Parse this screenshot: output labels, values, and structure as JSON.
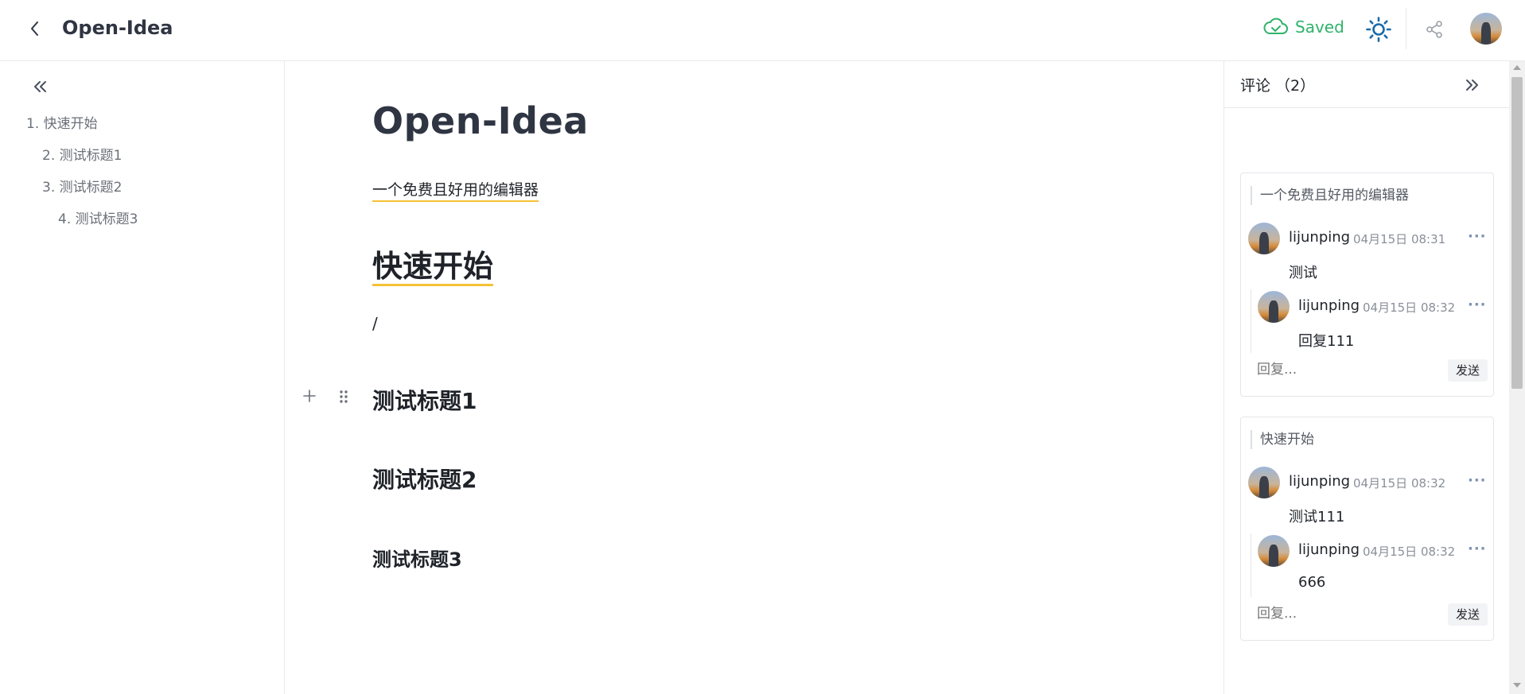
{
  "header": {
    "back_icon": "chevron-left-icon",
    "title": "Open-Idea",
    "saved_icon": "cloud-check-icon",
    "saved_label": "Saved",
    "theme_icon": "sun-icon",
    "share_icon": "share-icon",
    "colors": {
      "saved": "#2fb36b",
      "theme": "#1a6aa8"
    }
  },
  "sidebar": {
    "collapse_icon": "double-chevron-left-icon",
    "toc": [
      {
        "label": "1. 快速开始"
      },
      {
        "label": "2. 测试标题1"
      },
      {
        "label": "3. 测试标题2"
      },
      {
        "label": "4. 测试标题3"
      }
    ]
  },
  "editor": {
    "title": "Open-Idea",
    "subtitle": "一个免费且好用的编辑器",
    "h1": "快速开始",
    "slash": "/",
    "h2a": "测试标题1",
    "h2b": "测试标题2",
    "h3": "测试标题3",
    "add_icon": "plus-icon",
    "drag_icon": "drag-handle-icon",
    "highlight_color": "#f5c234"
  },
  "comments": {
    "title": "评论 （2）",
    "collapse_icon": "double-chevron-right-icon",
    "cards": [
      {
        "quote": "一个免费且好用的编辑器",
        "comment": {
          "user": "lijunping",
          "time": "04月15日 08:31",
          "more": "···",
          "text": "测试"
        },
        "reply": {
          "user": "lijunping",
          "time": "04月15日 08:32",
          "more": "···",
          "text": "回复111"
        },
        "reply_placeholder": "回复...",
        "send_label": "发送"
      },
      {
        "quote": "快速开始",
        "comment": {
          "user": "lijunping",
          "time": "04月15日 08:32",
          "more": "···",
          "text": "测试111"
        },
        "reply": {
          "user": "lijunping",
          "time": "04月15日 08:32",
          "more": "···",
          "text": "666"
        },
        "reply_placeholder": "回复...",
        "send_label": "发送"
      }
    ]
  }
}
